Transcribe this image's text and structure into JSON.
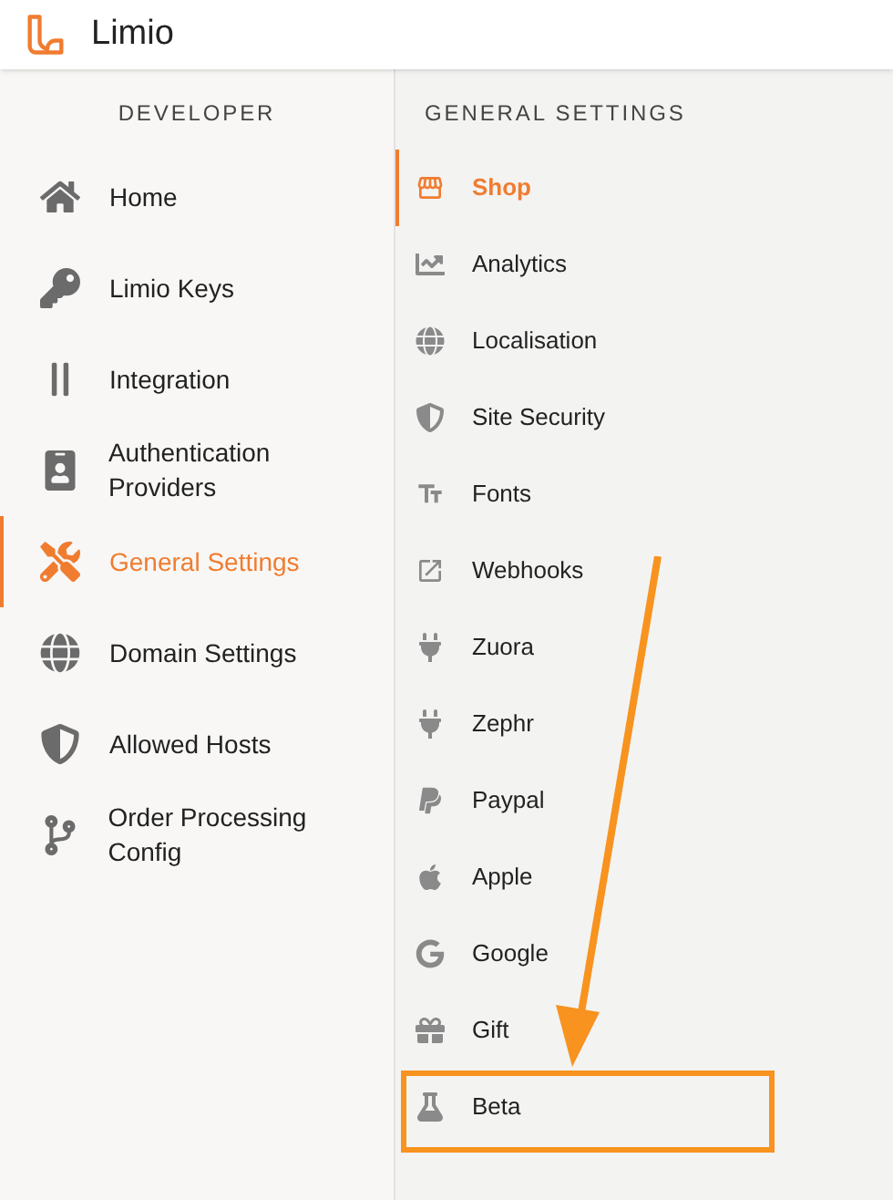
{
  "header": {
    "title": "Limio"
  },
  "developer_menu": {
    "heading": "DEVELOPER",
    "items": [
      {
        "label": "Home",
        "selected": false
      },
      {
        "label": "Limio Keys",
        "selected": false
      },
      {
        "label": "Integration",
        "selected": false
      },
      {
        "label": "Authentication Providers",
        "selected": false
      },
      {
        "label": "General Settings",
        "selected": true
      },
      {
        "label": "Domain Settings",
        "selected": false
      },
      {
        "label": "Allowed Hosts",
        "selected": false
      },
      {
        "label": "Order Processing Config",
        "selected": false
      }
    ]
  },
  "settings_menu": {
    "heading": "GENERAL SETTINGS",
    "items": [
      {
        "label": "Shop",
        "selected": true
      },
      {
        "label": "Analytics",
        "selected": false
      },
      {
        "label": "Localisation",
        "selected": false
      },
      {
        "label": "Site Security",
        "selected": false
      },
      {
        "label": "Fonts",
        "selected": false
      },
      {
        "label": "Webhooks",
        "selected": false
      },
      {
        "label": "Zuora",
        "selected": false
      },
      {
        "label": "Zephr",
        "selected": false
      },
      {
        "label": "Paypal",
        "selected": false
      },
      {
        "label": "Apple",
        "selected": false
      },
      {
        "label": "Google",
        "selected": false
      },
      {
        "label": "Gift",
        "selected": false
      },
      {
        "label": "Beta",
        "selected": false
      }
    ]
  }
}
